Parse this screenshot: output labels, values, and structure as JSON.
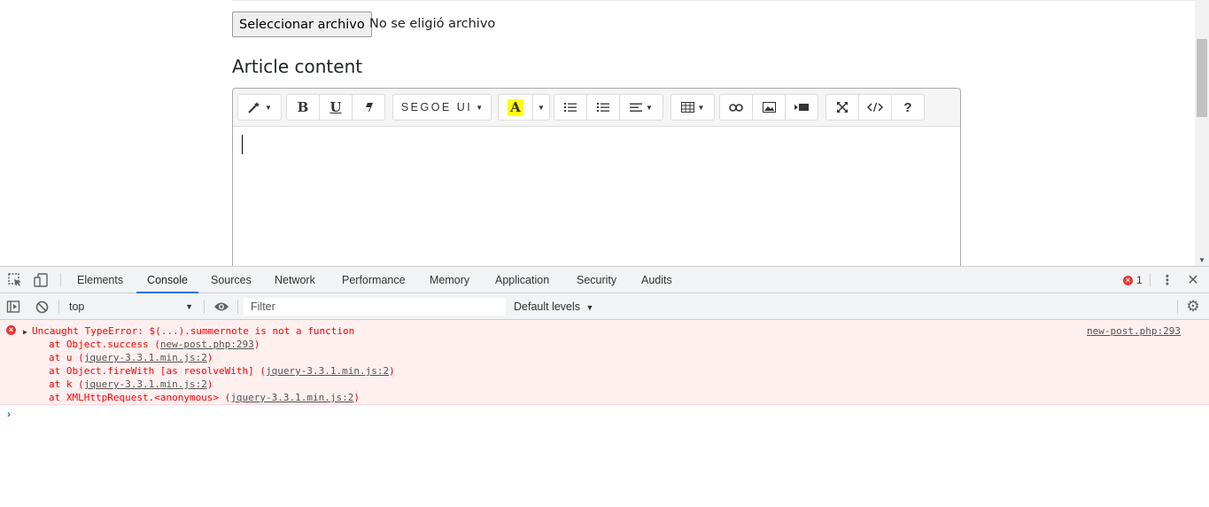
{
  "page": {
    "file_button_label": "Seleccionar archivo",
    "file_status": "No se eligió archivo",
    "section_title": "Article content"
  },
  "editor": {
    "font_name": "SEGOE UI",
    "bold_label": "B",
    "underline_label": "U",
    "help_label": "?",
    "highlight_label": "A",
    "highlight_color": "#ffff00",
    "icons": [
      "magic-icon",
      "eraser-icon",
      "highlight-icon",
      "unordered-list-icon",
      "ordered-list-icon",
      "align-icon",
      "table-icon",
      "link-icon",
      "picture-icon",
      "video-icon",
      "fullscreen-icon",
      "code-view-icon",
      "help-icon"
    ]
  },
  "devtools": {
    "tabs": [
      "Elements",
      "Console",
      "Sources",
      "Network",
      "Performance",
      "Memory",
      "Application",
      "Security",
      "Audits"
    ],
    "active_tab": "Console",
    "error_count": "1",
    "context": "top",
    "filter_placeholder": "Filter",
    "levels_label": "Default levels",
    "accent_color": "#1a73e8",
    "error_color": "#ff0000"
  },
  "console": {
    "error_message": "Uncaught TypeError: $(...).summernote is not a function",
    "stack": [
      {
        "prefix": "at Object.success (",
        "link": "new-post.php:293",
        "suffix": ")"
      },
      {
        "prefix": "at u (",
        "link": "jquery-3.3.1.min.js:2",
        "suffix": ")"
      },
      {
        "prefix": "at Object.fireWith [as resolveWith] (",
        "link": "jquery-3.3.1.min.js:2",
        "suffix": ")"
      },
      {
        "prefix": "at k (",
        "link": "jquery-3.3.1.min.js:2",
        "suffix": ")"
      },
      {
        "prefix": "at XMLHttpRequest.<anonymous> (",
        "link": "jquery-3.3.1.min.js:2",
        "suffix": ")"
      }
    ],
    "source": "new-post.php:293",
    "prompt_symbol": "›"
  }
}
